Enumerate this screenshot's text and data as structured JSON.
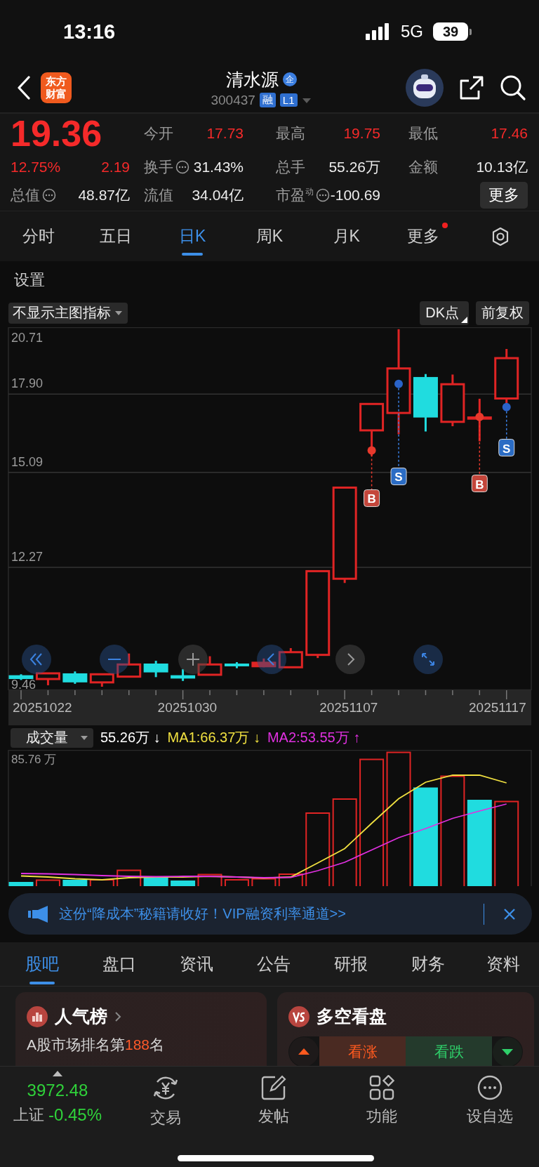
{
  "status_bar": {
    "time": "13:16",
    "network": "5G",
    "battery": "39"
  },
  "header": {
    "logo": "东方财富",
    "title": "清水源",
    "badge": "企",
    "code": "300437",
    "tags": [
      "融",
      "L1"
    ]
  },
  "quote": {
    "price": "19.36",
    "change_pct": "12.75%",
    "change": "2.19",
    "more_button": "更多",
    "stats": [
      {
        "label": "今开",
        "value": "17.73",
        "rising": true,
        "info": false
      },
      {
        "label": "最高",
        "value": "19.75",
        "rising": true,
        "info": false
      },
      {
        "label": "最低",
        "value": "17.46",
        "rising": true,
        "info": false
      },
      {
        "label": "换手",
        "value": "31.43%",
        "rising": false,
        "info": true
      },
      {
        "label": "总手",
        "value": "55.26万",
        "rising": false,
        "info": false
      },
      {
        "label": "金额",
        "value": "10.13亿",
        "rising": false,
        "info": false
      },
      {
        "label": "总值",
        "value": "48.87亿",
        "rising": false,
        "info": true
      },
      {
        "label": "流值",
        "value": "34.04亿",
        "rising": false,
        "info": false
      },
      {
        "label": "市盈$^{动}$",
        "value": "-100.69",
        "rising": false,
        "info": true
      }
    ]
  },
  "period_tabs": [
    {
      "label": "分时",
      "selected": false,
      "dot": false
    },
    {
      "label": "五日",
      "selected": false,
      "dot": false
    },
    {
      "label": "日K",
      "selected": true,
      "dot": false
    },
    {
      "label": "周K",
      "selected": false,
      "dot": false
    },
    {
      "label": "月K",
      "selected": false,
      "dot": false
    },
    {
      "label": "更多",
      "selected": false,
      "dot": true
    }
  ],
  "settings_link": "设置",
  "chart_toolbar": {
    "indicator_dropdown": "不显示主图指标",
    "dk_button": "DK点",
    "adjust_button": "前复权"
  },
  "chart": {
    "price_labels": [
      "20.71",
      "17.90",
      "15.09",
      "12.27",
      "9.46"
    ],
    "date_labels": [
      "20251022",
      "20251030",
      "20251107",
      "20251117"
    ],
    "signals": [
      {
        "label": "B",
        "kind": "buy"
      },
      {
        "label": "S",
        "kind": "sell"
      },
      {
        "label": "B",
        "kind": "buy"
      },
      {
        "label": "S",
        "kind": "sell"
      }
    ]
  },
  "volume": {
    "dropdown": "成交量",
    "current": "55.26万 ↓",
    "ma1": "MA1:66.37万 ↓",
    "ma2": "MA2:53.55万 ↑",
    "max_label": "85.76 万"
  },
  "banner": {
    "text": "这份“降成本”秘籍请收好！VIP融资利率通道>>"
  },
  "section_tabs": [
    {
      "label": "股吧",
      "selected": true
    },
    {
      "label": "盘口",
      "selected": false
    },
    {
      "label": "资讯",
      "selected": false
    },
    {
      "label": "公告",
      "selected": false
    },
    {
      "label": "研报",
      "selected": false
    },
    {
      "label": "财务",
      "selected": false
    },
    {
      "label": "资料",
      "selected": false
    }
  ],
  "cards": {
    "popularity": {
      "title": "人气榜",
      "text": "A股市场排名第**188**名"
    },
    "vote": {
      "title": "多空看盘",
      "bull": "看涨",
      "bear": "看跌"
    }
  },
  "bottom_nav": {
    "index": {
      "value": "3972.48",
      "name": "上证",
      "change": "-0.45%"
    },
    "items": [
      {
        "label": "交易"
      },
      {
        "label": "发帖"
      },
      {
        "label": "功能"
      },
      {
        "label": "设自选"
      }
    ]
  }
}
